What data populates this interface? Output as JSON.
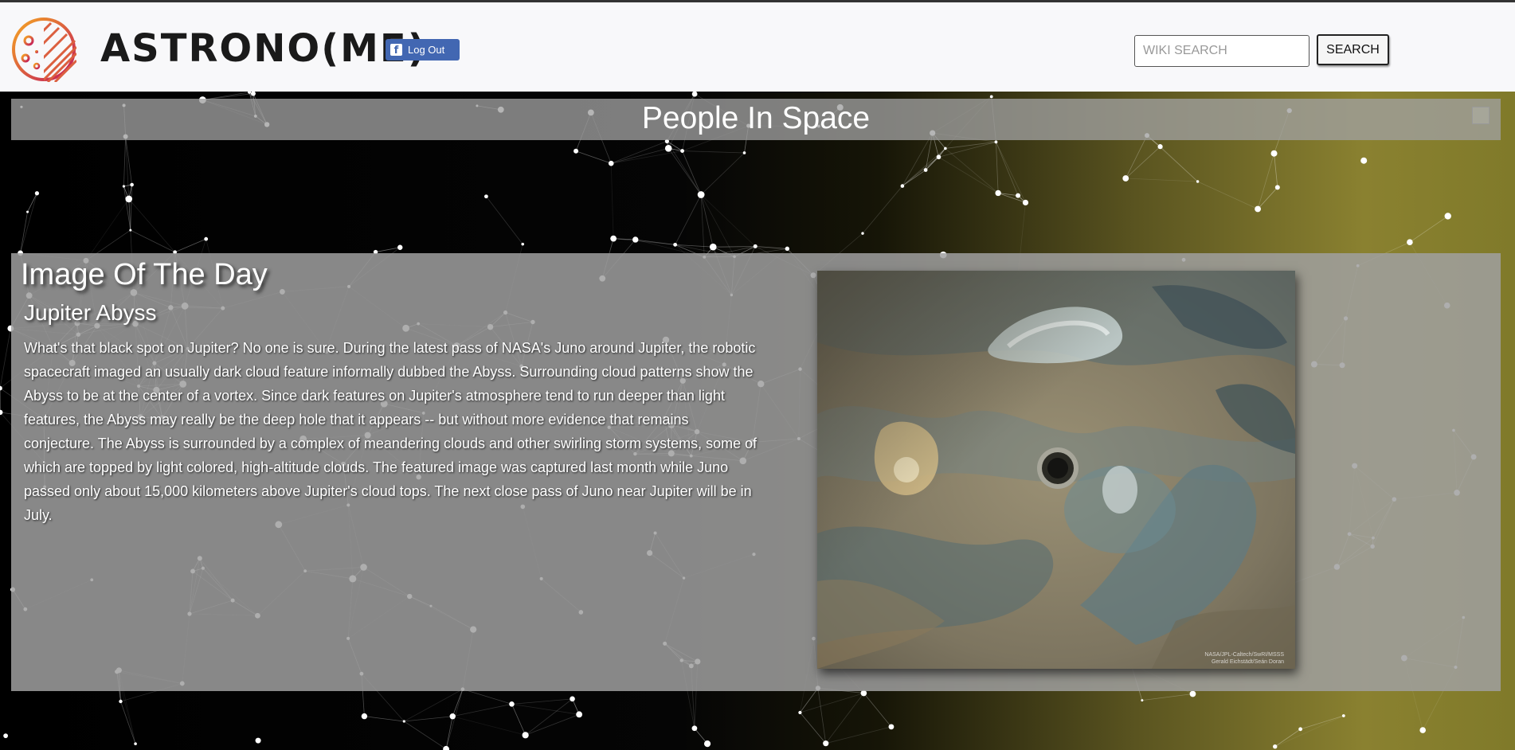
{
  "header": {
    "brand": "ASTRONO(ME)",
    "facebook_button": "Log Out",
    "search_placeholder": "WIKI SEARCH",
    "search_button": "SEARCH"
  },
  "people_in_space": {
    "title": "People In Space"
  },
  "image_of_the_day": {
    "heading": "Image Of The Day",
    "title": "Jupiter Abyss",
    "explanation": "What's that black spot on Jupiter? No one is sure. During the latest pass of NASA's Juno around Jupiter, the robotic spacecraft imaged an usually dark cloud feature informally dubbed the Abyss. Surrounding cloud patterns show the Abyss to be at the center of a vortex. Since dark features on Jupiter's atmosphere tend to run deeper than light features, the Abyss may really be the deep hole that it appears -- but without more evidence that remains conjecture. The Abyss is surrounded by a complex of meandering clouds and other swirling storm systems, some of which are topped by light colored, high-altitude clouds. The featured image was captured last month while Juno passed only about 15,000 kilometers above Jupiter's cloud tops. The next close pass of Juno near Jupiter will be in July.",
    "credit_line1": "NASA/JPL-Caltech/SwRI/MSSS",
    "credit_line2": "Gerald Eichstädt/Seán Doran"
  },
  "colors": {
    "facebook_blue": "#4267b2",
    "panel_gray": "#a0a0a0",
    "logo_gradient": [
      "#f5a623",
      "#c2185b"
    ]
  },
  "icons": {
    "logo": "moon-logo-icon",
    "facebook": "facebook-icon"
  }
}
